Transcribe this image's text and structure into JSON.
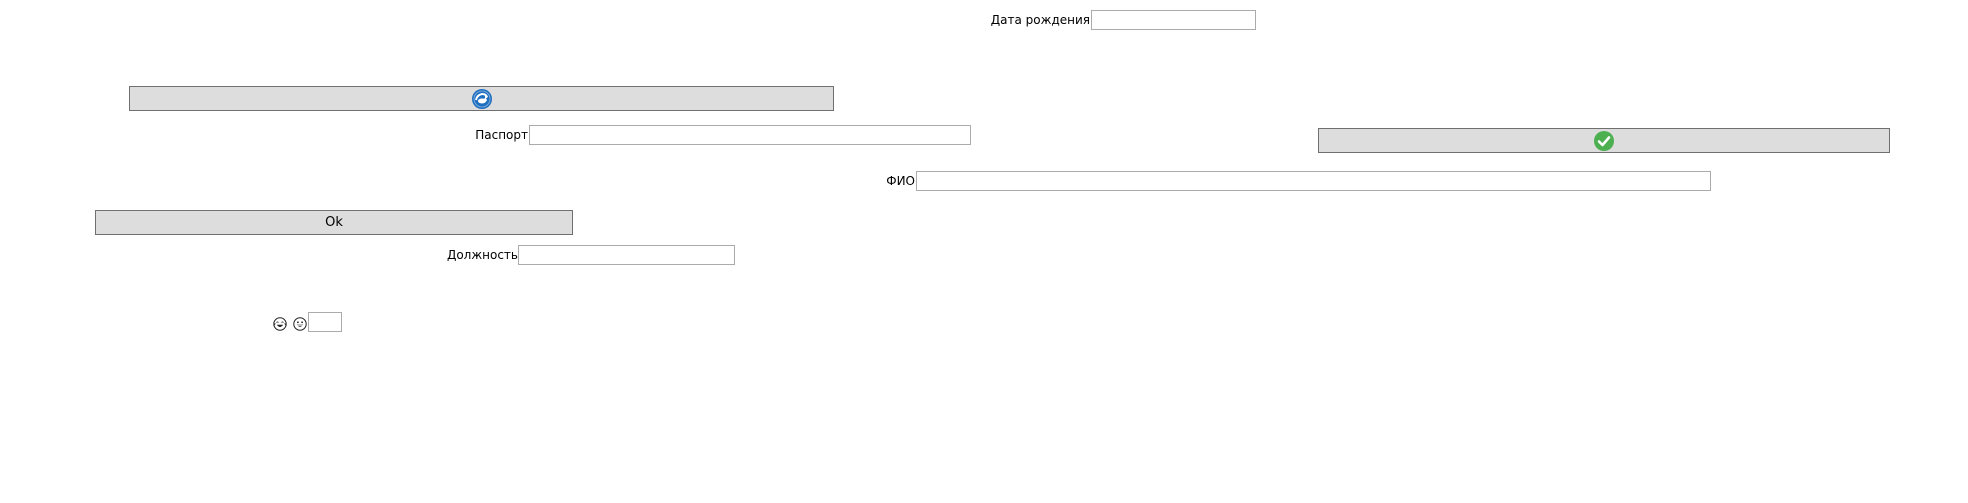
{
  "form": {
    "birth_date": {
      "label": "Дата рождения",
      "value": ""
    },
    "passport": {
      "label": "Паспорт",
      "value": ""
    },
    "full_name": {
      "label": "ФИО",
      "value": ""
    },
    "position": {
      "label": "Должность",
      "value": ""
    },
    "small_field": {
      "value": ""
    }
  },
  "buttons": {
    "refresh": {
      "icon": "refresh-globe-icon"
    },
    "confirm": {
      "icon": "green-check-icon"
    },
    "ok": {
      "label": "Ok"
    }
  },
  "icons": {
    "emoji_one": "laughing-face-icon",
    "emoji_two": "grinning-face-icon"
  },
  "colors": {
    "button_bg": "#dddddd",
    "button_border": "#707070",
    "field_border": "#ababab",
    "refresh_icon_blue": "#1e6fc0",
    "check_icon_green": "#4caf50"
  }
}
